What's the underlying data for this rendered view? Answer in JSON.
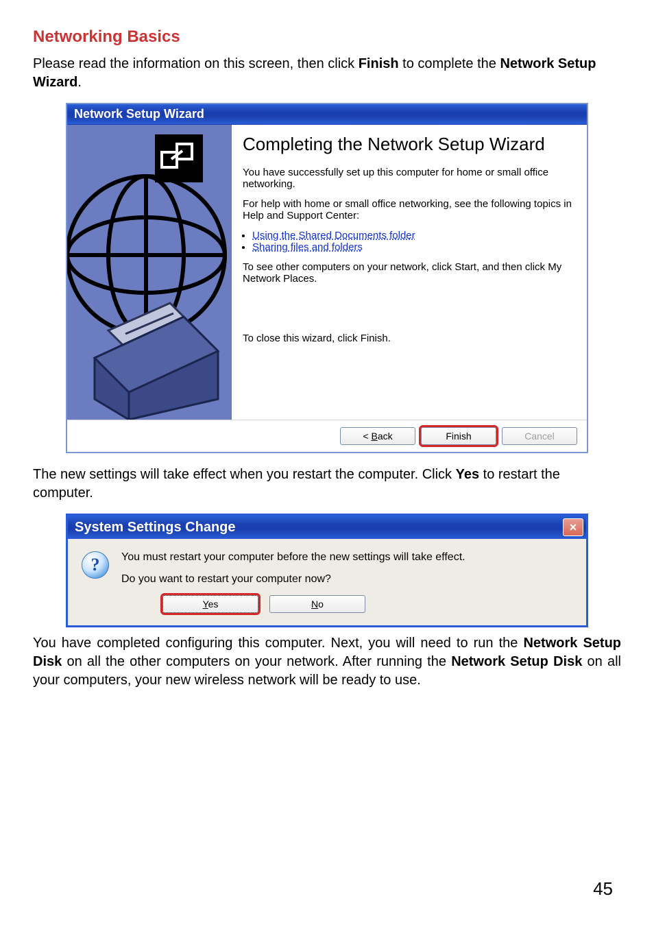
{
  "page": {
    "title": "Networking Basics",
    "intro_parts": [
      "Please read the information on this screen, then click ",
      "Finish",
      " to complete the ",
      "Network Setup Wizard",
      "."
    ],
    "mid_parts": [
      "The new settings will take effect when you restart the computer. Click ",
      "Yes",
      " to restart the computer."
    ],
    "outro_parts": [
      "You have completed configuring this computer. Next, you will need to run the ",
      "Network Setup Disk",
      " on all the other computers on your network. After running the ",
      "Network Setup Disk",
      " on all your computers, your new wireless network will be ready to use."
    ],
    "page_number": "45"
  },
  "wizard": {
    "title": "Network Setup Wizard",
    "heading": "Completing the Network Setup Wizard",
    "p1": "You have successfully set up this computer for home or small office networking.",
    "p2": "For help with home or small office networking, see the following topics in Help and Support Center:",
    "links": {
      "l1": "Using the Shared Documents folder",
      "l2": "Sharing files and folders"
    },
    "p3": "To see other computers on your network, click Start, and then click My Network Places.",
    "close_text": "To close this wizard, click Finish.",
    "buttons": {
      "back_pre": "< ",
      "back_u": "B",
      "back_post": "ack",
      "finish": "Finish",
      "cancel": "Cancel"
    }
  },
  "dialog": {
    "title": "System Settings Change",
    "close_glyph": "×",
    "question_glyph": "?",
    "line1": "You must restart your computer before the new settings will take effect.",
    "line2": "Do you want to restart your computer now?",
    "buttons": {
      "yes_u": "Y",
      "yes_post": "es",
      "no_u": "N",
      "no_post": "o"
    }
  }
}
